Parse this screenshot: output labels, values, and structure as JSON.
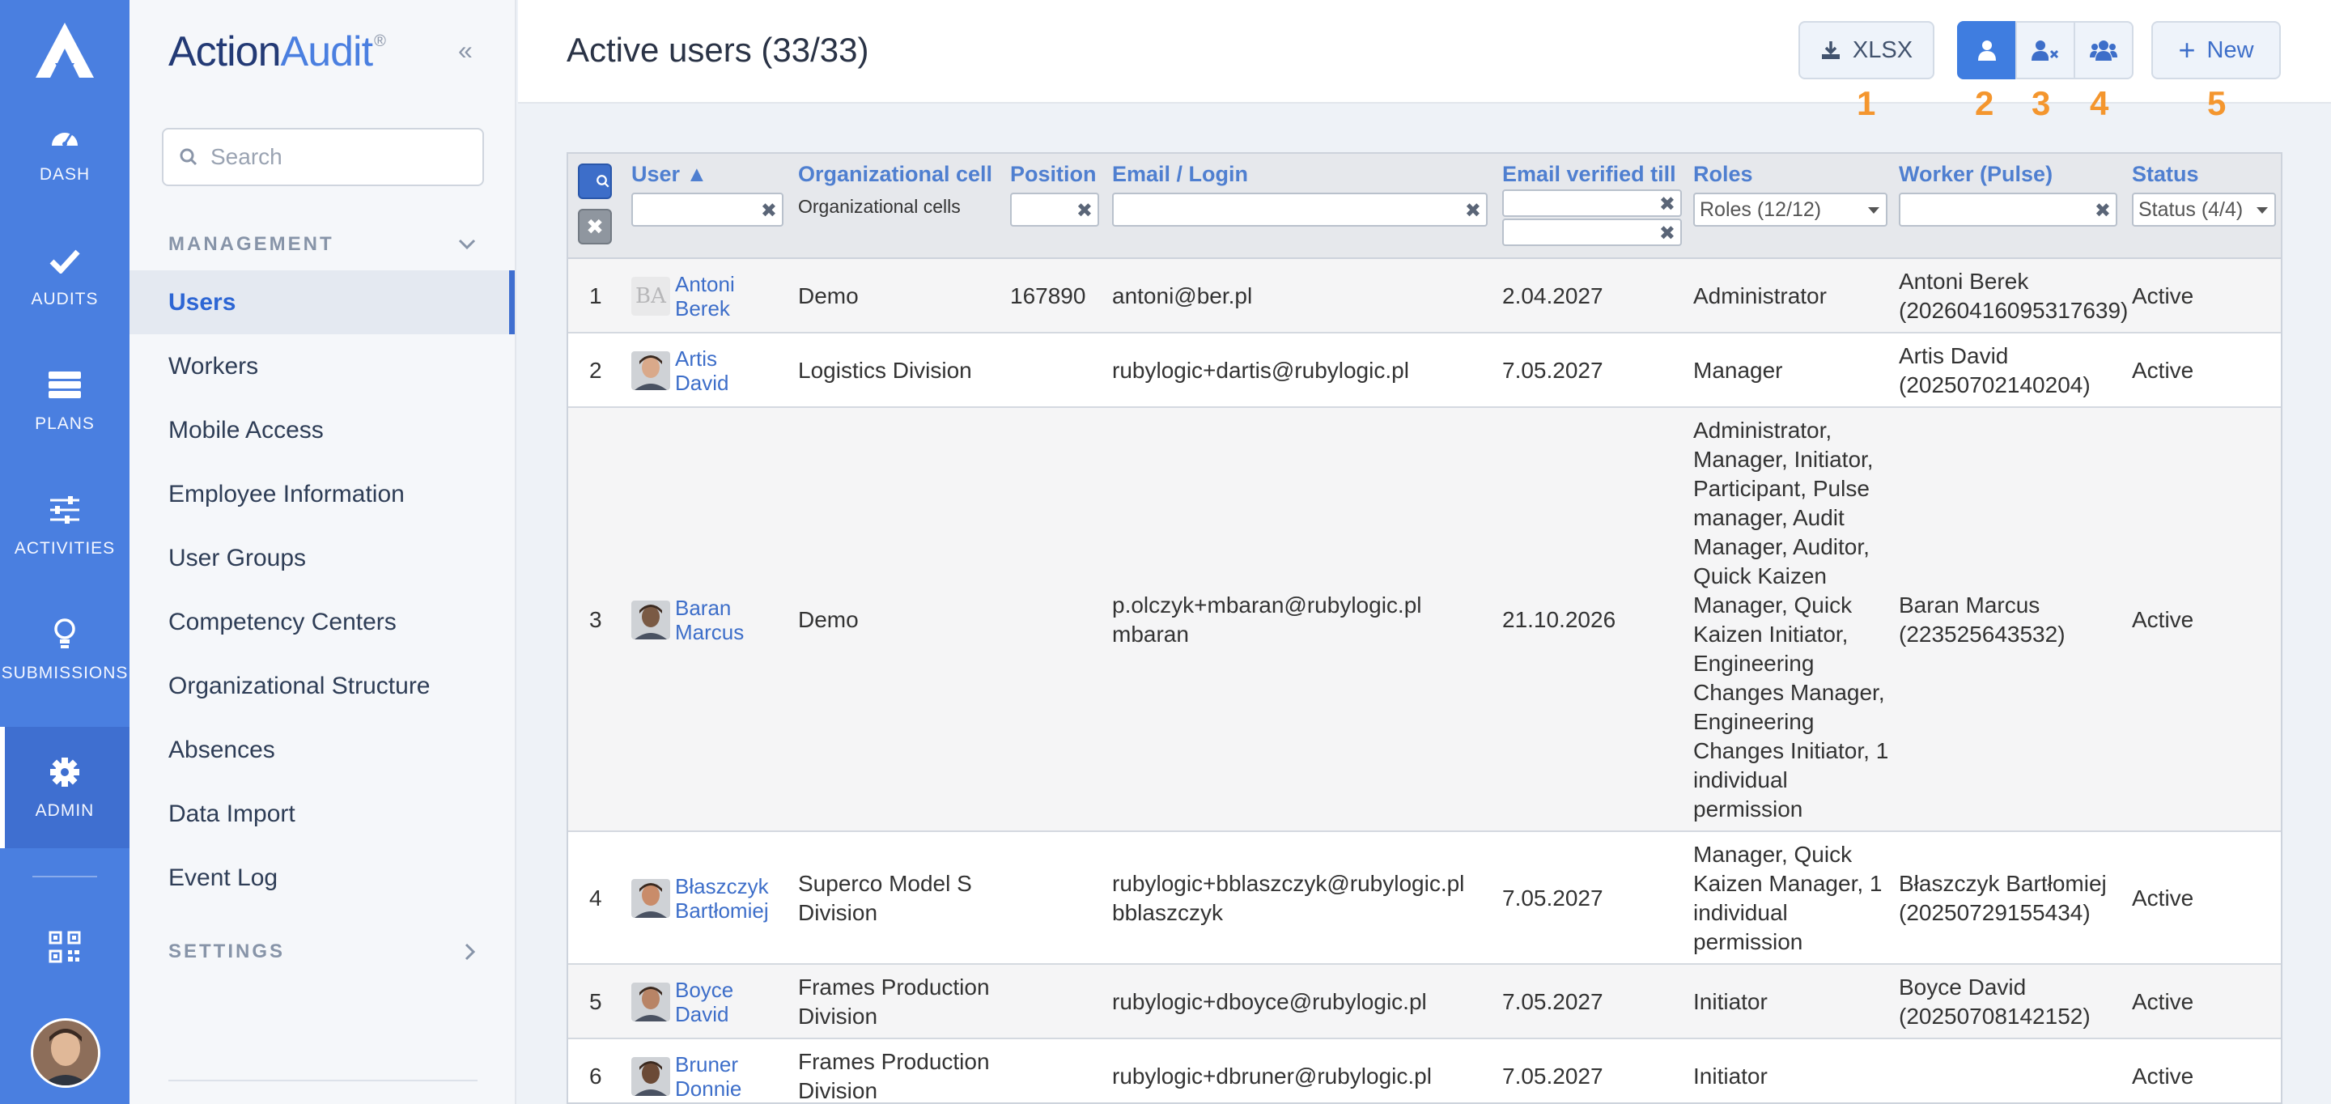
{
  "rail": {
    "items": [
      {
        "label": "DASH",
        "icon": "gauge-icon"
      },
      {
        "label": "AUDITS",
        "icon": "check-icon"
      },
      {
        "label": "PLANS",
        "icon": "plans-icon"
      },
      {
        "label": "ACTIVITIES",
        "icon": "sliders-icon"
      },
      {
        "label": "SUBMISSIONS",
        "icon": "lightbulb-icon"
      },
      {
        "label": "ADMIN",
        "icon": "gear-icon"
      }
    ],
    "active": "ADMIN"
  },
  "brand": {
    "part1": "Action",
    "part2": "Audit",
    "mark": "®"
  },
  "sidebar": {
    "search_placeholder": "Search",
    "management_title": "MANAGEMENT",
    "settings_title": "SETTINGS",
    "items": [
      {
        "label": "Users"
      },
      {
        "label": "Workers"
      },
      {
        "label": "Mobile Access"
      },
      {
        "label": "Employee Information"
      },
      {
        "label": "User Groups"
      },
      {
        "label": "Competency Centers"
      },
      {
        "label": "Organizational Structure"
      },
      {
        "label": "Absences"
      },
      {
        "label": "Data Import"
      },
      {
        "label": "Event Log"
      }
    ]
  },
  "header": {
    "title": "Active users (33/33)",
    "xlsx_label": "XLSX",
    "new_label": "New",
    "annotations": [
      "1",
      "2",
      "3",
      "4",
      "5"
    ]
  },
  "table": {
    "columns": {
      "user": "User ▲",
      "org_cell": "Organizational cell",
      "org_cell_sub": "Organizational cells",
      "position": "Position",
      "email": "Email / Login",
      "email_verified": "Email verified till",
      "roles": "Roles",
      "worker": "Worker (Pulse)",
      "status": "Status"
    },
    "filters": {
      "roles": "Roles (12/12)",
      "status": "Status (4/4)"
    },
    "rows": [
      {
        "n": "1",
        "first": "Antoni",
        "last": "Berek",
        "avatar": "BA",
        "org": [
          "Demo"
        ],
        "position": "167890",
        "email": [
          "antoni@ber.pl"
        ],
        "verified": "2.04.2027",
        "roles": [
          "Administrator"
        ],
        "worker": [
          "Antoni Berek",
          "(20260416095317639)"
        ],
        "status": "Active"
      },
      {
        "n": "2",
        "first": "Artis",
        "last": "David",
        "avatar": "",
        "org": [
          "Logistics Division"
        ],
        "position": "",
        "email": [
          "rubylogic+dartis@rubylogic.pl"
        ],
        "verified": "7.05.2027",
        "roles": [
          "Manager"
        ],
        "worker": [
          "Artis David",
          "(20250702140204)"
        ],
        "status": "Active"
      },
      {
        "n": "3",
        "first": "Baran",
        "last": "Marcus",
        "avatar": "",
        "org": [
          "Demo"
        ],
        "position": "",
        "email": [
          "p.olczyk+mbaran@rubylogic.pl",
          "mbaran"
        ],
        "verified": "21.10.2026",
        "roles": [
          "Administrator,",
          "Manager, Initiator,",
          "Participant, Pulse",
          "manager, Audit",
          "Manager, Auditor,",
          "Quick Kaizen",
          "Manager, Quick",
          "Kaizen Initiator,",
          "Engineering",
          "Changes Manager,",
          "Engineering",
          "Changes Initiator, 1",
          "individual",
          "permission"
        ],
        "worker": [
          "Baran Marcus",
          "(223525643532)"
        ],
        "status": "Active"
      },
      {
        "n": "4",
        "first": "Błaszczyk",
        "last": "Bartłomiej",
        "avatar": "",
        "org": [
          "Superco Model S",
          "Division"
        ],
        "position": "",
        "email": [
          "rubylogic+bblaszczyk@rubylogic.pl",
          "bblaszczyk"
        ],
        "verified": "7.05.2027",
        "roles": [
          "Manager, Quick",
          "Kaizen Manager, 1",
          "individual",
          "permission"
        ],
        "worker": [
          "Błaszczyk Bartłomiej",
          "(20250729155434)"
        ],
        "status": "Active"
      },
      {
        "n": "5",
        "first": "Boyce",
        "last": "David",
        "avatar": "",
        "org": [
          "Frames Production",
          "Division"
        ],
        "position": "",
        "email": [
          "rubylogic+dboyce@rubylogic.pl"
        ],
        "verified": "7.05.2027",
        "roles": [
          "Initiator"
        ],
        "worker": [
          "Boyce David",
          "(20250708142152)"
        ],
        "status": "Active"
      },
      {
        "n": "6",
        "first": "Bruner",
        "last": "Donnie",
        "avatar": "",
        "org": [
          "Frames Production",
          "Division"
        ],
        "position": "",
        "email": [
          "rubylogic+dbruner@rubylogic.pl"
        ],
        "verified": "7.05.2027",
        "roles": [
          "Initiator"
        ],
        "worker": [],
        "status": "Active"
      }
    ]
  },
  "colors": {
    "rail": "#4a7fe0",
    "link": "#3d6ec9",
    "annotation": "#f4962e"
  }
}
